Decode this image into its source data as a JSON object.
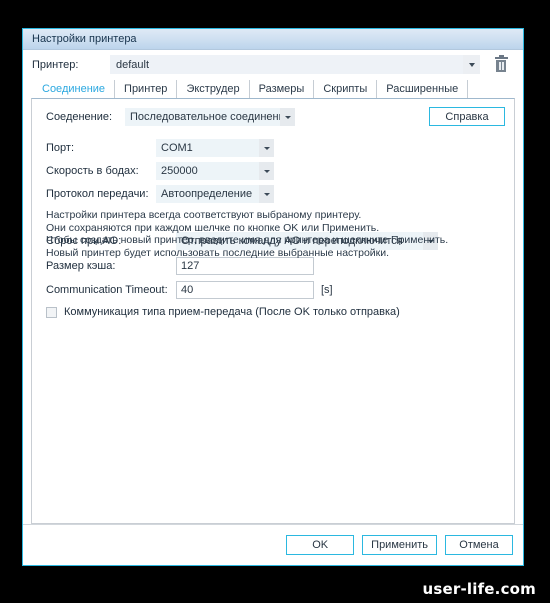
{
  "window": {
    "title": "Настройки принтера"
  },
  "printer_row": {
    "label": "Принтер:",
    "value": "default",
    "dropdown_icon": "chevron-down-icon",
    "delete_icon": "trash-icon"
  },
  "tabs": [
    {
      "label": "Соединение",
      "active": true
    },
    {
      "label": "Принтер",
      "active": false
    },
    {
      "label": "Экструдер",
      "active": false
    },
    {
      "label": "Размеры",
      "active": false
    },
    {
      "label": "Скрипты",
      "active": false
    },
    {
      "label": "Расширенные",
      "active": false
    }
  ],
  "help_button": {
    "label": "Справка"
  },
  "fields": {
    "connection": {
      "label": "Соеденение:",
      "value": "Последовательное соединение"
    },
    "port": {
      "label": "Порт:",
      "value": "COM1"
    },
    "baud_rate": {
      "label": "Скорость в бодах:",
      "value": "250000"
    },
    "transfer_protocol": {
      "label": "Протокол передачи:",
      "value": "Автоопределение"
    },
    "reset_on_ao": {
      "label": "Сброс при AO:",
      "value": "Отправить команду AO и переподключится"
    },
    "cache_size": {
      "label": "Размер кэша:",
      "value": "127"
    },
    "communication_timeout": {
      "label": "Communication Timeout:",
      "value": "40",
      "unit": "[s]"
    },
    "ping_pong": {
      "label": "Коммуникация типа прием-передача (После OK только отправка)",
      "checked": false
    }
  },
  "info_text": {
    "line1": "Настройки принтера всегда соответствуют выбраному принтеру.",
    "line2": "Они сохраняются при каждом шелчке по кнопке OK или Применить.",
    "line3": "Чтобы создать новый принтер, введите имя для принтера и шелкните Применить.",
    "line4": "Новый принтер будет использовать последние выбранные настройки."
  },
  "buttons": {
    "ok": "OK",
    "apply": "Применить",
    "cancel": "Отмена"
  },
  "watermark": {
    "text": "user-life.com"
  },
  "colors": {
    "accent": "#2bb8e0",
    "title_text": "#17334d",
    "active_tab_text": "#2ba8e0",
    "field_fill": "#edf4f8",
    "background": "#000000"
  }
}
